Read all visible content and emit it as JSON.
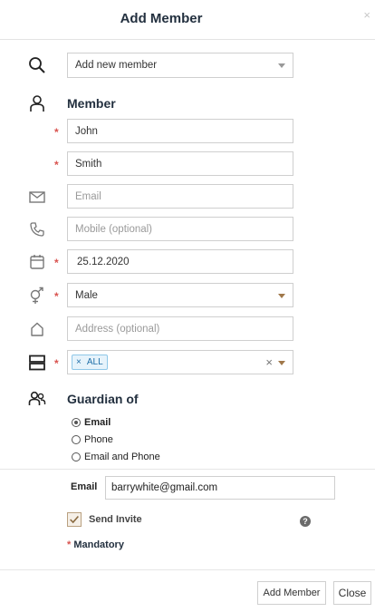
{
  "dialog": {
    "title": "Add Member",
    "close_symbol": "×"
  },
  "search": {
    "select_value": "Add new member"
  },
  "member": {
    "heading": "Member",
    "first_name": "John",
    "last_name": "Smith",
    "email_placeholder": "Email",
    "mobile_placeholder": "Mobile (optional)",
    "birth_date": "25.12.2020",
    "gender": "Male",
    "address_placeholder": "Address (optional)",
    "groups": {
      "tag_remove": "×",
      "tag_label": "ALL",
      "clear_symbol": "×"
    },
    "required_marker": "*"
  },
  "guardian": {
    "heading": "Guardian of",
    "contact_options": [
      {
        "label": "Email",
        "checked": true
      },
      {
        "label": "Phone",
        "checked": false
      },
      {
        "label": "Email and Phone",
        "checked": false
      }
    ],
    "email_label": "Email",
    "email_value": "barrywhite@gmail.com",
    "send_invite_label": "Send Invite",
    "send_invite_checked": true,
    "help_symbol": "?"
  },
  "footer": {
    "mandatory_star": "*",
    "mandatory_text": " Mandatory",
    "add_button": "Add Member",
    "close_button": "Close"
  },
  "icons": {
    "search": "search-icon",
    "member": "person-icon",
    "email": "envelope-icon",
    "phone": "phone-icon",
    "date": "calendar-icon",
    "gender": "gender-icon",
    "address": "home-icon",
    "groups": "groups-icon",
    "guardian": "guardian-icon"
  },
  "colors": {
    "title": "#23303f",
    "required": "#d9534f",
    "tag_background": "#e6f3fb",
    "tag_text": "#1f6fa8",
    "dropdown_caret": "#a0784a"
  }
}
